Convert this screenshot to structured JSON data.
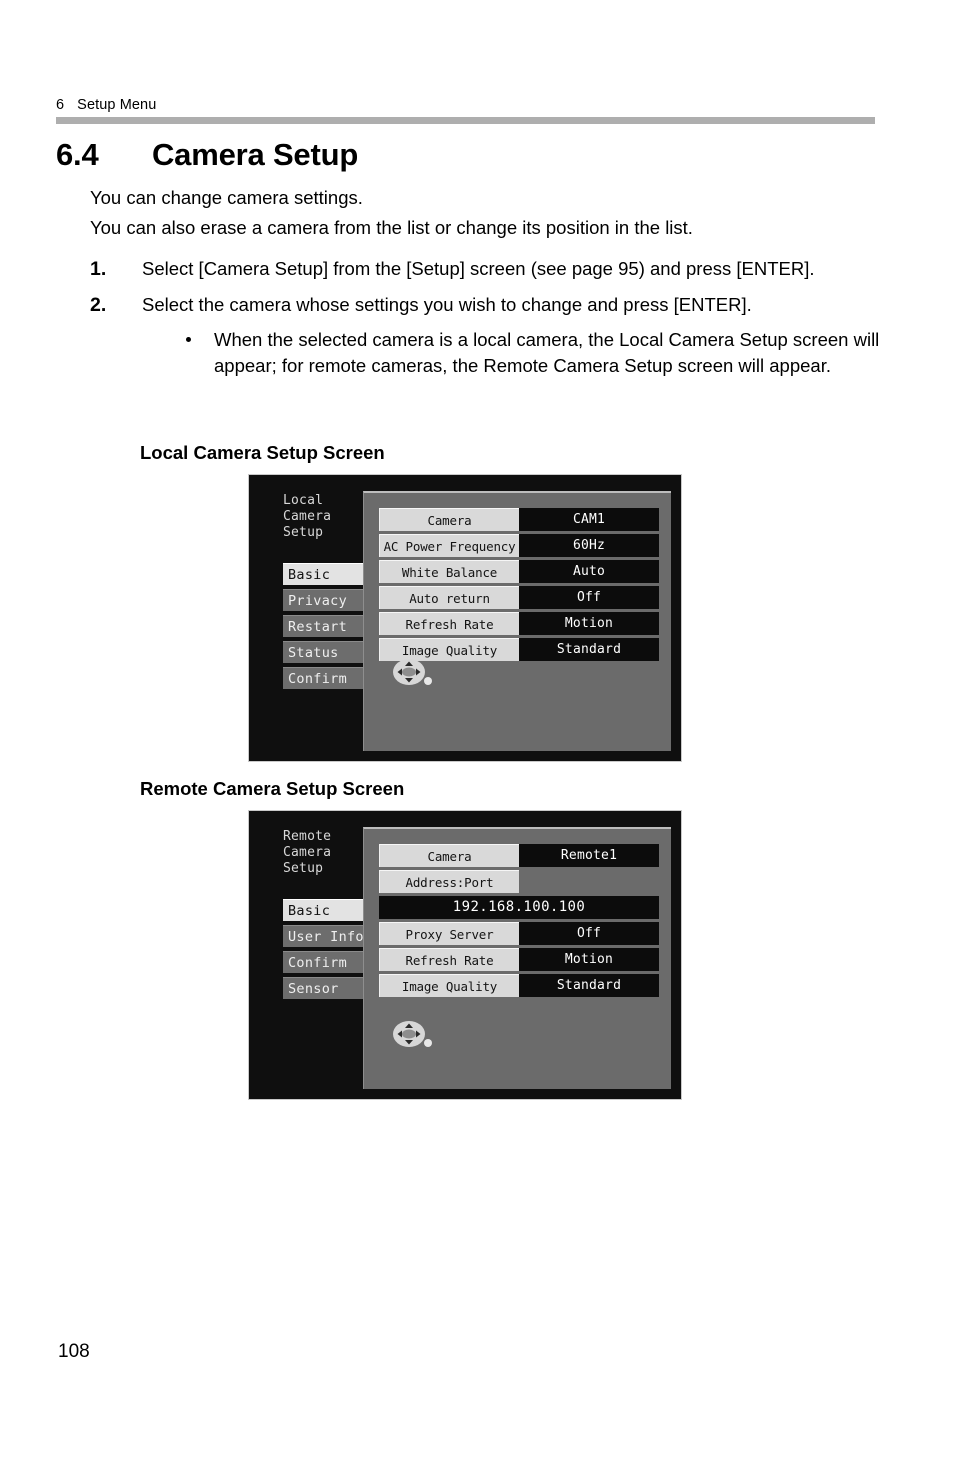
{
  "header": {
    "chapter_number": "6",
    "chapter_title": "Setup Menu"
  },
  "section": {
    "number": "6.4",
    "title": "Camera Setup"
  },
  "intro": {
    "line1": "You can change camera settings.",
    "line2": "You can also erase a camera from the list or change its position in the list."
  },
  "steps": [
    {
      "num": "1.",
      "text": "Select [Camera Setup] from the [Setup] screen (see page 95) and press [ENTER]."
    },
    {
      "num": "2.",
      "text": "Select the camera whose settings you wish to change and press [ENTER].",
      "bullets": [
        "When the selected camera is a local camera, the Local Camera Setup screen will appear; for remote cameras, the Remote Camera Setup screen will appear."
      ]
    }
  ],
  "figures": {
    "local": {
      "heading": "Local Camera Setup Screen",
      "osd_title": "Local\nCamera\nSetup",
      "osd_title_lines": [
        "Local",
        "Camera",
        "Setup"
      ],
      "tabs": [
        {
          "label": "Basic",
          "active": true
        },
        {
          "label": "Privacy",
          "active": false
        },
        {
          "label": "Restart",
          "active": false
        },
        {
          "label": "Status",
          "active": false
        },
        {
          "label": "Confirm",
          "active": false
        }
      ],
      "rows": [
        {
          "label": "Camera",
          "value": "CAM1"
        },
        {
          "label": "AC Power Frequency",
          "value": "60Hz"
        },
        {
          "label": "White Balance",
          "value": "Auto"
        },
        {
          "label": "Auto return",
          "value": "Off"
        },
        {
          "label": "Refresh Rate",
          "value": "Motion"
        },
        {
          "label": "Image Quality",
          "value": "Standard"
        }
      ],
      "nav_icon": "dpad-icon"
    },
    "remote": {
      "heading": "Remote Camera Setup Screen",
      "osd_title_lines": [
        "Remote",
        "Camera",
        "Setup"
      ],
      "tabs": [
        {
          "label": "Basic",
          "active": true
        },
        {
          "label": "User Info",
          "active": false
        },
        {
          "label": "Confirm",
          "active": false
        },
        {
          "label": "Sensor",
          "active": false
        }
      ],
      "rows": [
        {
          "label": "Camera",
          "value": "Remote1"
        },
        {
          "label": "Address:Port",
          "value": ""
        },
        {
          "label": "",
          "value": "192.168.100.100"
        },
        {
          "label": "Proxy Server",
          "value": "Off"
        },
        {
          "label": "Refresh Rate",
          "value": "Motion"
        },
        {
          "label": "Image Quality",
          "value": "Standard"
        }
      ],
      "nav_icon": "dpad-icon"
    }
  },
  "page_number": "108",
  "colors": {
    "header_rule": "#aeaeae",
    "osd_background": "#0f0f0f",
    "osd_panel": "#6b6b6b",
    "osd_label": "#d9d9d9",
    "osd_tab_inactive": "#6d6d6d",
    "osd_tab_active": "#e3e3e3"
  }
}
